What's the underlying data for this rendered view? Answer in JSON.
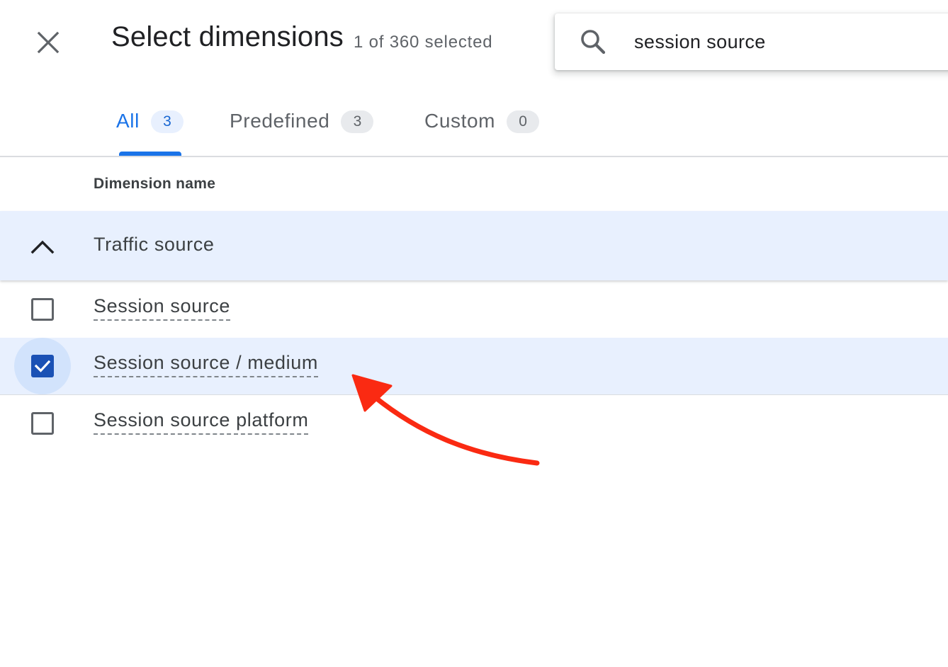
{
  "header": {
    "title": "Select dimensions",
    "subtitle": "1 of 360 selected",
    "close_icon": "close-icon"
  },
  "search": {
    "icon": "search-icon",
    "value": "session source"
  },
  "tabs": [
    {
      "label": "All",
      "count": "3",
      "active": true
    },
    {
      "label": "Predefined",
      "count": "3",
      "active": false
    },
    {
      "label": "Custom",
      "count": "0",
      "active": false
    }
  ],
  "table": {
    "column_header": "Dimension name",
    "group": {
      "label": "Traffic source",
      "expanded": true,
      "icon": "chevron-up-icon"
    },
    "items": [
      {
        "label": "Session source",
        "checked": false
      },
      {
        "label": "Session source / medium",
        "checked": true
      },
      {
        "label": "Session source platform",
        "checked": false
      }
    ]
  },
  "annotation": {
    "type": "arrow",
    "color": "#fa2a12",
    "points_to": "Session source / medium"
  },
  "colors": {
    "accent": "#1a73e8",
    "selected_row_bg": "#e8f0fe",
    "checkbox_checked": "#1a51b5"
  }
}
